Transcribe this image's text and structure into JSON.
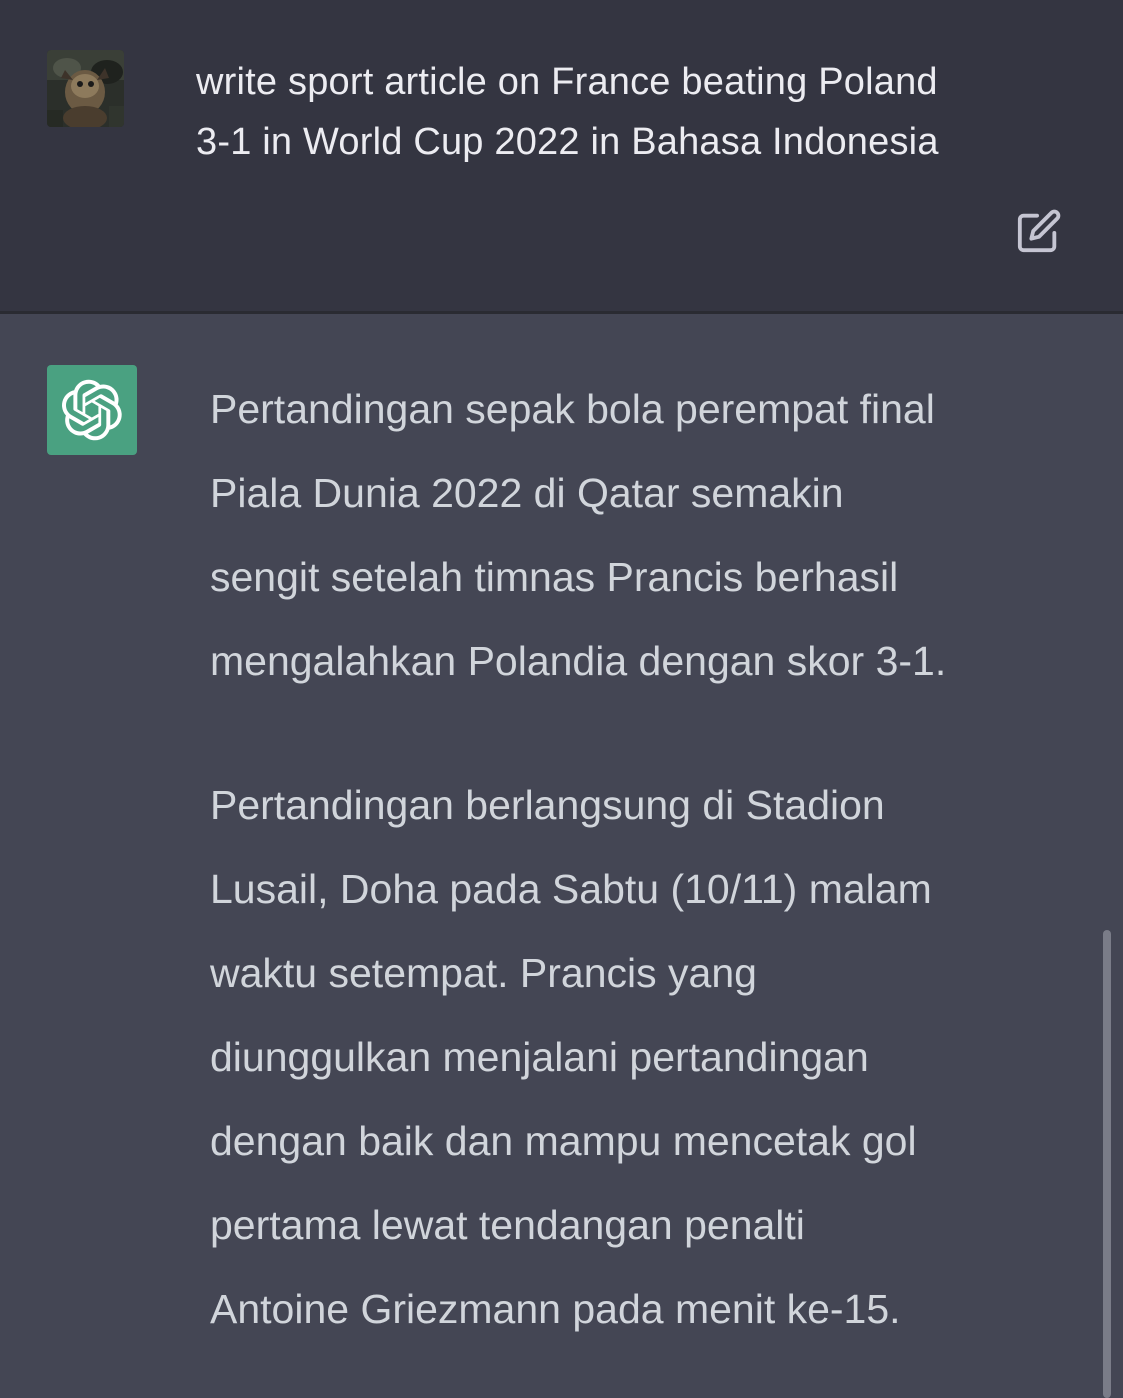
{
  "user_message": {
    "text": "write sport article on France beating Poland\n3-1 in World Cup 2022 in Bahasa Indonesia",
    "avatar_icon": "user-avatar-photo",
    "edit_icon": "edit-icon"
  },
  "assistant_message": {
    "avatar_icon": "openai-logo-icon",
    "avatar_color": "#4aa181",
    "paragraphs": [
      "Pertandingan sepak bola perempat final\nPiala Dunia 2022 di Qatar semakin\nsengit setelah timnas Prancis berhasil\nmengalahkan Polandia dengan skor 3-1.",
      "Pertandingan berlangsung di Stadion\nLusail, Doha pada Sabtu (10/11) malam\nwaktu setempat. Prancis yang\ndiunggulkan menjalani pertandingan\ndengan baik dan mampu mencetak gol\npertama lewat tendangan penalti\nAntoine Griezmann pada menit ke-15."
    ]
  },
  "colors": {
    "user_bg": "#343541",
    "assistant_bg": "#444654",
    "text": "#d1d5db"
  }
}
